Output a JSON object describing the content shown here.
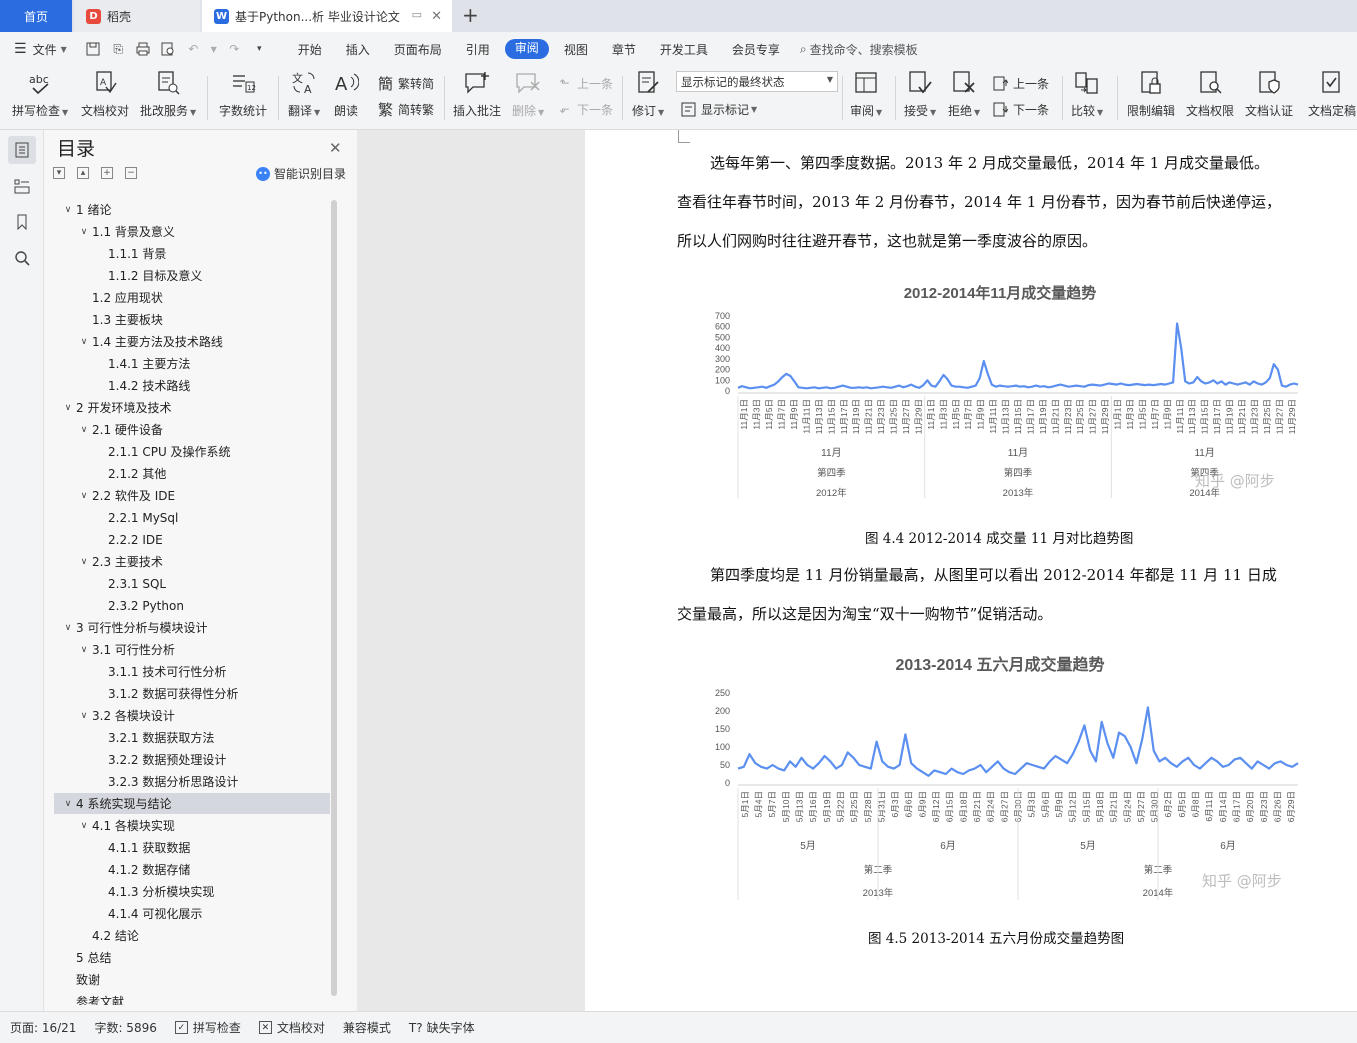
{
  "tabs": [
    {
      "label": "首页"
    },
    {
      "label": "稻壳"
    },
    {
      "label": "基于Python...析 毕业设计论文"
    }
  ],
  "menu": {
    "file": "文件",
    "tabs": [
      "开始",
      "插入",
      "页面布局",
      "引用",
      "审阅",
      "视图",
      "章节",
      "开发工具",
      "会员专享"
    ],
    "search": "查找命令、搜索模板"
  },
  "ribbon": {
    "spell": "拼写检查",
    "proof": "文档校对",
    "annot": "批改服务",
    "wordcount": "字数统计",
    "translate": "翻译",
    "read": "朗读",
    "t2s": "繁转简",
    "s2t": "简转繁",
    "insert_comment": "插入批注",
    "delete": "删除",
    "prev_comment": "上一条",
    "next_comment": "下一条",
    "revise": "修订",
    "markup_state": "显示标记的最终状态",
    "show_markup": "显示标记",
    "review": "审阅",
    "accept": "接受",
    "reject": "拒绝",
    "prev": "上一条",
    "next": "下一条",
    "compare": "比较",
    "restrict": "限制编辑",
    "rights": "文档权限",
    "cert": "文档认证",
    "finalize": "文档定稿"
  },
  "toc": {
    "title": "目录",
    "smart": "智能识别目录",
    "items": [
      {
        "text": "1  绪论",
        "level": 0,
        "exp": true
      },
      {
        "text": "1.1  背景及意义",
        "level": 1,
        "exp": true
      },
      {
        "text": "1.1.1  背景",
        "level": 2
      },
      {
        "text": "1.1.2  目标及意义",
        "level": 2
      },
      {
        "text": "1.2  应用现状",
        "level": 1
      },
      {
        "text": "1.3  主要板块",
        "level": 1
      },
      {
        "text": "1.4  主要方法及技术路线",
        "level": 1,
        "exp": true
      },
      {
        "text": "1.4.1  主要方法",
        "level": 2
      },
      {
        "text": "1.4.2  技术路线",
        "level": 2
      },
      {
        "text": "2 开发环境及技术",
        "level": 0,
        "exp": true
      },
      {
        "text": "2.1 硬件设备",
        "level": 1,
        "exp": true
      },
      {
        "text": "2.1.1 CPU 及操作系统",
        "level": 2
      },
      {
        "text": "2.1.2  其他",
        "level": 2
      },
      {
        "text": "2.2 软件及 IDE",
        "level": 1,
        "exp": true
      },
      {
        "text": "2.2.1 MySql",
        "level": 2
      },
      {
        "text": "2.2.2 IDE",
        "level": 2
      },
      {
        "text": "2.3 主要技术",
        "level": 1,
        "exp": true
      },
      {
        "text": "2.3.1 SQL",
        "level": 2
      },
      {
        "text": "2.3.2 Python",
        "level": 2
      },
      {
        "text": "3  可行性分析与模块设计",
        "level": 0,
        "exp": true
      },
      {
        "text": "3.1  可行性分析",
        "level": 1,
        "exp": true
      },
      {
        "text": "3.1.1  技术可行性分析",
        "level": 2
      },
      {
        "text": "3.1.2  数据可获得性分析",
        "level": 2
      },
      {
        "text": "3.2  各模块设计",
        "level": 1,
        "exp": true
      },
      {
        "text": "3.2.1  数据获取方法",
        "level": 2
      },
      {
        "text": "3.2.2  数据预处理设计",
        "level": 2
      },
      {
        "text": "3.2.3  数据分析思路设计",
        "level": 2
      },
      {
        "text": "4  系统实现与结论",
        "level": 0,
        "exp": true,
        "sel": true
      },
      {
        "text": "4.1  各模块实现",
        "level": 1,
        "exp": true
      },
      {
        "text": "4.1.1  获取数据",
        "level": 2
      },
      {
        "text": "4.1.2  数据存储",
        "level": 2
      },
      {
        "text": "4.1.3  分析模块实现",
        "level": 2
      },
      {
        "text": "4.1.4  可视化展示",
        "level": 2
      },
      {
        "text": "4.2  结论",
        "level": 1
      },
      {
        "text": "5 总结",
        "level": 0
      },
      {
        "text": "致谢",
        "level": 0
      },
      {
        "text": "参考文献",
        "level": 0
      }
    ]
  },
  "document": {
    "para1": [
      "选每年第一、第四季度数据。2013 年 2 月成交量最低，2014 年 1 月成交量最低。",
      "查看往年春节时间，2013 年 2 月份春节，2014 年 1 月份春节，因为春节前后快递停运，",
      "所以人们网购时往往避开春节，这也就是第一季度波谷的原因。"
    ],
    "caption1": "图 4.4 2012-2014 成交量 11 月对比趋势图",
    "para2": [
      "第四季度均是 11 月份销量最高，从图里可以看出 2012-2014 年都是 11 月 11 日成",
      "交量最高，所以这是因为淘宝“双十一购物节”促销活动。"
    ],
    "caption2": "图 4.5 2013-2014 五六月份成交量趋势图",
    "watermark": "知乎 @阿步"
  },
  "chart_data": [
    {
      "type": "line",
      "title": "2012-2014年11月成交量趋势",
      "ylim": [
        0,
        700
      ],
      "yticks": [
        0,
        100,
        200,
        300,
        400,
        500,
        600,
        700
      ],
      "color": "#5b8ff0",
      "x_ticks": [
        "11月1日",
        "11月3日",
        "11月5日",
        "11月7日",
        "11月9日",
        "11月11日",
        "11月13日",
        "11月15日",
        "11月17日",
        "11月19日",
        "11月21日",
        "11月23日",
        "11月25日",
        "11月27日",
        "11月29日",
        "11月1日",
        "11月3日",
        "11月5日",
        "11月7日",
        "11月9日",
        "11月11日",
        "11月13日",
        "11月15日",
        "11月17日",
        "11月19日",
        "11月21日",
        "11月23日",
        "11月25日",
        "11月27日",
        "11月29日",
        "11月1日",
        "11月3日",
        "11月5日",
        "11月7日",
        "11月9日",
        "11月11日",
        "11月13日",
        "11月15日",
        "11月17日",
        "11月19日",
        "11月21日",
        "11月23日",
        "11月25日",
        "11月27日",
        "11月29日"
      ],
      "groups": [
        {
          "month": "11月",
          "quarter": "第四季",
          "year": "2012年"
        },
        {
          "month": "11月",
          "quarter": "第四季",
          "year": "2013年"
        },
        {
          "month": "11月",
          "quarter": "第四季",
          "year": "2014年"
        }
      ],
      "values": [
        30,
        45,
        35,
        25,
        30,
        35,
        40,
        30,
        45,
        60,
        90,
        130,
        160,
        140,
        90,
        35,
        30,
        25,
        30,
        35,
        25,
        30,
        35,
        25,
        30,
        40,
        50,
        40,
        30,
        30,
        35,
        30,
        35,
        25,
        30,
        35,
        40,
        35,
        30,
        40,
        50,
        35,
        45,
        60,
        40,
        30,
        55,
        100,
        50,
        40,
        90,
        150,
        110,
        50,
        40,
        40,
        35,
        30,
        40,
        50,
        120,
        280,
        160,
        60,
        40,
        50,
        45,
        40,
        45,
        50,
        40,
        45,
        35,
        40,
        50,
        40,
        45,
        35,
        40,
        50,
        60,
        50,
        40,
        45,
        50,
        45,
        40,
        55,
        60,
        55,
        50,
        60,
        70,
        65,
        60,
        70,
        60,
        55,
        60,
        65,
        60,
        55,
        60,
        55,
        60,
        65,
        60,
        70,
        80,
        630,
        400,
        90,
        70,
        80,
        130,
        90,
        70,
        80,
        100,
        70,
        90,
        60,
        80,
        70,
        60,
        70,
        80,
        60,
        90,
        70,
        60,
        80,
        120,
        250,
        200,
        50,
        40,
        60,
        70,
        60
      ]
    },
    {
      "type": "line",
      "title": "2013-2014 五六月成交量趋势",
      "ylim": [
        0,
        250
      ],
      "yticks": [
        0,
        50,
        100,
        150,
        200,
        250
      ],
      "color": "#5b8ff0",
      "x_ticks": [
        "5月1日",
        "5月4日",
        "5月7日",
        "5月10日",
        "5月13日",
        "5月16日",
        "5月19日",
        "5月22日",
        "5月25日",
        "5月28日",
        "5月31日",
        "6月3日",
        "6月6日",
        "6月9日",
        "6月12日",
        "6月15日",
        "6月18日",
        "6月21日",
        "6月24日",
        "6月27日",
        "6月30日",
        "5月3日",
        "5月6日",
        "5月9日",
        "5月12日",
        "5月15日",
        "5月18日",
        "5月21日",
        "5月24日",
        "5月27日",
        "5月30日",
        "6月2日",
        "6月5日",
        "6月8日",
        "6月11日",
        "6月14日",
        "6月17日",
        "6月20日",
        "6月23日",
        "6月26日",
        "6月29日"
      ],
      "groups": [
        {
          "month": "5月",
          "quarter": "第二季",
          "year": "2013年"
        },
        {
          "month": "6月"
        },
        {
          "month": "5月",
          "quarter": "第二季",
          "year": "2014年"
        },
        {
          "month": "6月"
        }
      ],
      "values": [
        40,
        45,
        80,
        55,
        45,
        40,
        50,
        40,
        35,
        60,
        45,
        70,
        50,
        40,
        55,
        75,
        60,
        40,
        50,
        85,
        70,
        50,
        45,
        40,
        115,
        60,
        45,
        40,
        50,
        135,
        55,
        40,
        30,
        20,
        35,
        30,
        25,
        40,
        30,
        25,
        35,
        40,
        50,
        30,
        45,
        60,
        40,
        30,
        25,
        40,
        55,
        50,
        45,
        40,
        60,
        75,
        65,
        55,
        80,
        115,
        160,
        90,
        60,
        170,
        110,
        70,
        140,
        130,
        100,
        55,
        120,
        210,
        90,
        60,
        70,
        55,
        45,
        60,
        70,
        50,
        40,
        55,
        70,
        60,
        45,
        50,
        65,
        70,
        55,
        40,
        60,
        50,
        40,
        55,
        60,
        50,
        45,
        55
      ]
    }
  ],
  "status": {
    "page": "页面: 16/21",
    "words": "字数: 5896",
    "spell": "拼写检查",
    "proof": "文档校对",
    "compat": "兼容模式",
    "font": "缺失字体"
  }
}
